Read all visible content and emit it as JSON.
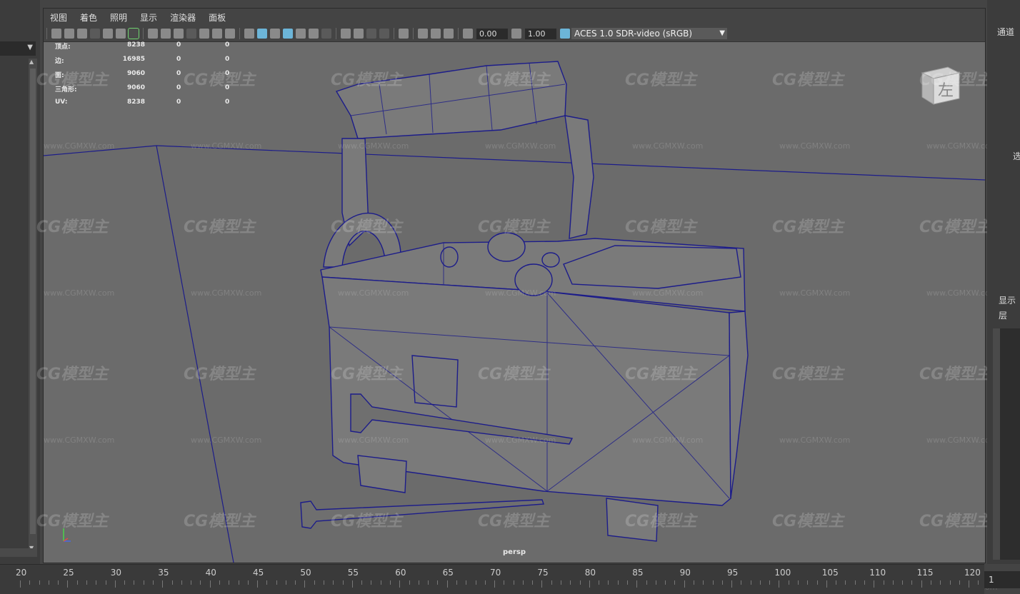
{
  "menu": [
    "视图",
    "着色",
    "照明",
    "显示",
    "渲染器",
    "面板"
  ],
  "toolbar": {
    "exposure": "0.00",
    "gamma": "1.00",
    "colorspace": "ACES 1.0 SDR-video (sRGB)"
  },
  "hud": [
    {
      "label": "顶点:",
      "v1": "8238",
      "v2": "0",
      "v3": "0"
    },
    {
      "label": "边:",
      "v1": "16985",
      "v2": "0",
      "v3": "0"
    },
    {
      "label": "面:",
      "v1": "9060",
      "v2": "0",
      "v3": "0"
    },
    {
      "label": "三角形:",
      "v1": "9060",
      "v2": "0",
      "v3": "0"
    },
    {
      "label": "UV:",
      "v1": "8238",
      "v2": "0",
      "v3": "0"
    }
  ],
  "viewcube_label": "左",
  "camera": "persp",
  "right_panel": {
    "channels": "通道",
    "select": "选",
    "display": "显示",
    "layer": "层",
    "layer2": " "
  },
  "watermark": {
    "logo": "CG模型主",
    "url": "www.CGMXW.com"
  },
  "timeline": {
    "ticks": [
      "20",
      "25",
      "30",
      "35",
      "40",
      "45",
      "50",
      "55",
      "60",
      "65",
      "70",
      "75",
      "80",
      "85",
      "90",
      "95",
      "100",
      "105",
      "110",
      "115",
      "120"
    ],
    "current_frame": "1"
  },
  "colors": {
    "wire": "#1c1c8a",
    "viewport_bg": "#6b6b6b",
    "highlight": "#6cb5d8"
  }
}
